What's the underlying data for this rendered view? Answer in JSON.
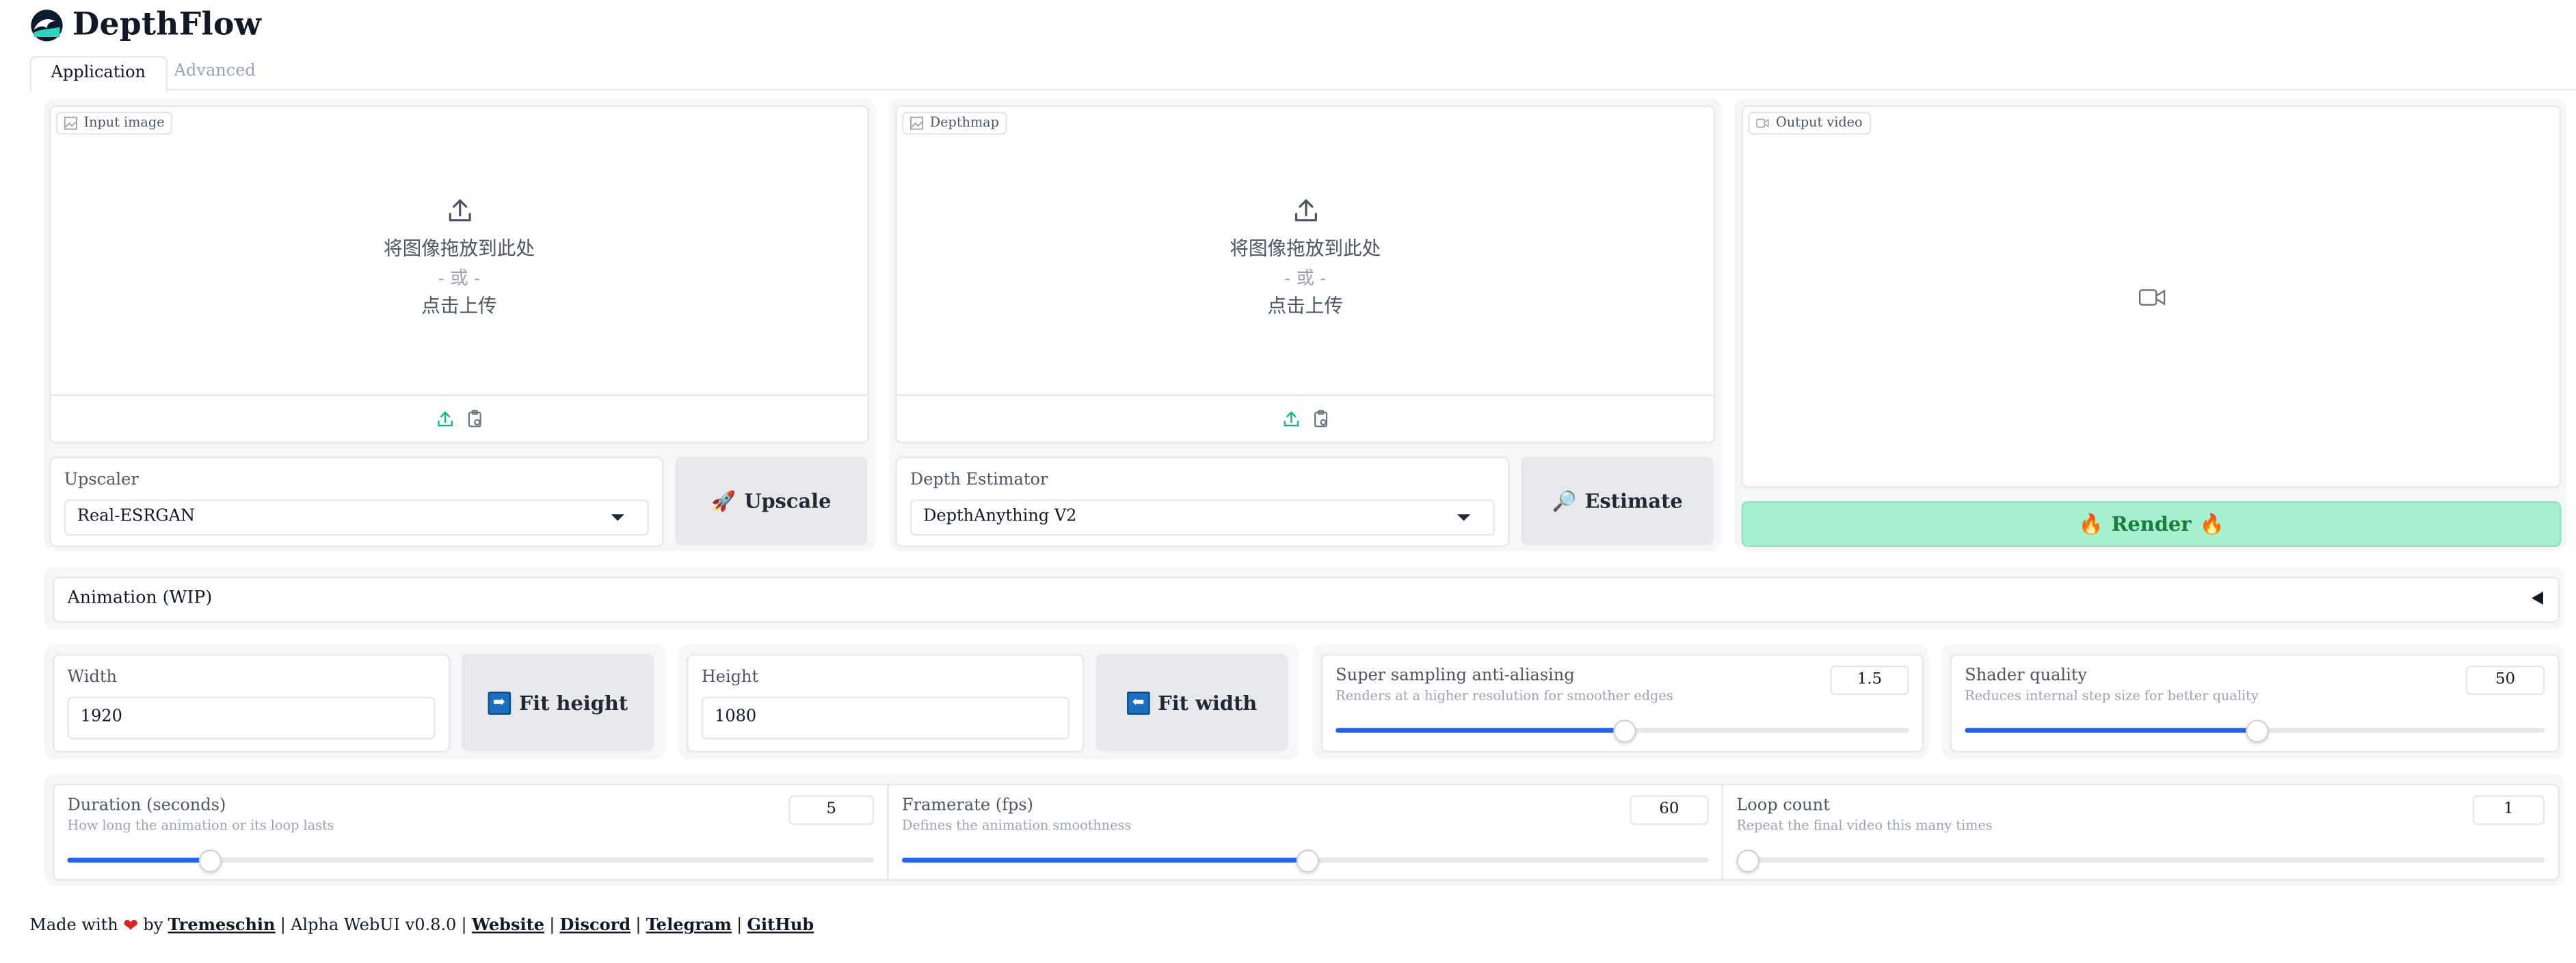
{
  "app": {
    "title": "DepthFlow"
  },
  "tabs": [
    {
      "label": "Application"
    },
    {
      "label": "Advanced"
    }
  ],
  "input_image": {
    "label": "Input image",
    "drop_text": "将图像拖放到此处",
    "or_text": "- 或 -",
    "click_text": "点击上传"
  },
  "depthmap": {
    "label": "Depthmap",
    "drop_text": "将图像拖放到此处",
    "or_text": "- 或 -",
    "click_text": "点击上传"
  },
  "output_video": {
    "label": "Output video"
  },
  "upscaler": {
    "label": "Upscaler",
    "value": "Real-ESRGAN",
    "button": "Upscale",
    "button_icon": "🚀"
  },
  "depth_estimator": {
    "label": "Depth Estimator",
    "value": "DepthAnything V2",
    "button": "Estimate",
    "button_icon": "🔎"
  },
  "render": {
    "label": "Render",
    "icon": "🔥"
  },
  "animation": {
    "label": "Animation (WIP)"
  },
  "width": {
    "label": "Width",
    "value": "1920",
    "button": "Fit height",
    "button_icon": "➡"
  },
  "height": {
    "label": "Height",
    "value": "1080",
    "button": "Fit width",
    "button_icon": "⬅"
  },
  "ssaa": {
    "label": "Super sampling anti-aliasing",
    "info": "Renders at a higher resolution for smoother edges",
    "value": "1.5",
    "fraction": 0.5
  },
  "quality": {
    "label": "Shader quality",
    "info": "Reduces internal step size for better quality",
    "value": "50",
    "fraction": 0.5
  },
  "duration": {
    "label": "Duration (seconds)",
    "info": "How long the animation or its loop lasts",
    "value": "5",
    "fraction": 0.175
  },
  "fps": {
    "label": "Framerate (fps)",
    "info": "Defines the animation smoothness",
    "value": "60",
    "fraction": 0.5
  },
  "loop": {
    "label": "Loop count",
    "info": "Repeat the final video this many times",
    "value": "1",
    "fraction": 0.0
  },
  "footer": {
    "made_with": "Made with",
    "by": "by",
    "author": "Tremeschin",
    "sep": "|",
    "version": "Alpha WebUI v0.8.0",
    "links": [
      "Website",
      "Discord",
      "Telegram",
      "GitHub"
    ]
  },
  "colors": {
    "accent": "#2563eb",
    "render_bg": "#a7f0cf",
    "render_text": "#15803d"
  }
}
